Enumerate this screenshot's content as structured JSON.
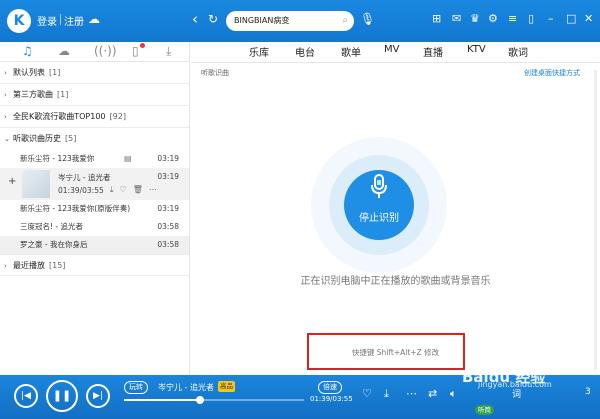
{
  "header": {
    "logo_letter": "K",
    "login": "登录",
    "register": "注册",
    "search_value": "BINGBIAN病变"
  },
  "left_tabs": [
    "music-note-icon",
    "cloud-icon",
    "radio-icon",
    "device-icon",
    "download-icon"
  ],
  "groups": [
    {
      "label": "默认列表",
      "count": "[1]"
    },
    {
      "label": "第三方歌曲",
      "count": "[1]"
    },
    {
      "label": "全民K歌流行歌曲TOP100",
      "count": "[92]"
    },
    {
      "label": "听歌识曲历史",
      "count": "[5]"
    },
    {
      "label": "最近播放",
      "count": "[15]"
    }
  ],
  "songs": [
    {
      "title": "新乐尘符 - 123我爱你",
      "time": "03:19"
    },
    {
      "title": "岑宁儿 - 追光者",
      "progress": "01:39/03:55",
      "time": "03:19"
    },
    {
      "title": "新乐尘符 - 123我爱你(原版伴奏)",
      "time": "03:19"
    },
    {
      "title": "三度冠名! - 追光者",
      "time": "03:58"
    },
    {
      "title": "罗之豪 - 我在你身后",
      "time": "03:58"
    }
  ],
  "content_tabs": [
    "乐库",
    "电台",
    "歌单",
    "MV",
    "直播",
    "KTV",
    "歌词"
  ],
  "content": {
    "subtitle": "听歌识曲",
    "link": "创建桌面快捷方式",
    "stop_label": "停止识别",
    "hint": "正在识别电脑中正在播放的歌曲或背景音乐",
    "shortcut": "快捷键  Shift+Alt+Z  修改"
  },
  "player": {
    "mode": "玩转",
    "title": "岑宁儿 - 追光者",
    "quality_badge": "高品",
    "speed": "倍速",
    "time": "01:39/03:55",
    "progress_fraction": 0.42,
    "listen_badge": "听筒",
    "lyric_label": "词",
    "count": "3"
  },
  "watermark": {
    "brand": "Baidu 经验",
    "url": "jingyan.baidu.com"
  }
}
